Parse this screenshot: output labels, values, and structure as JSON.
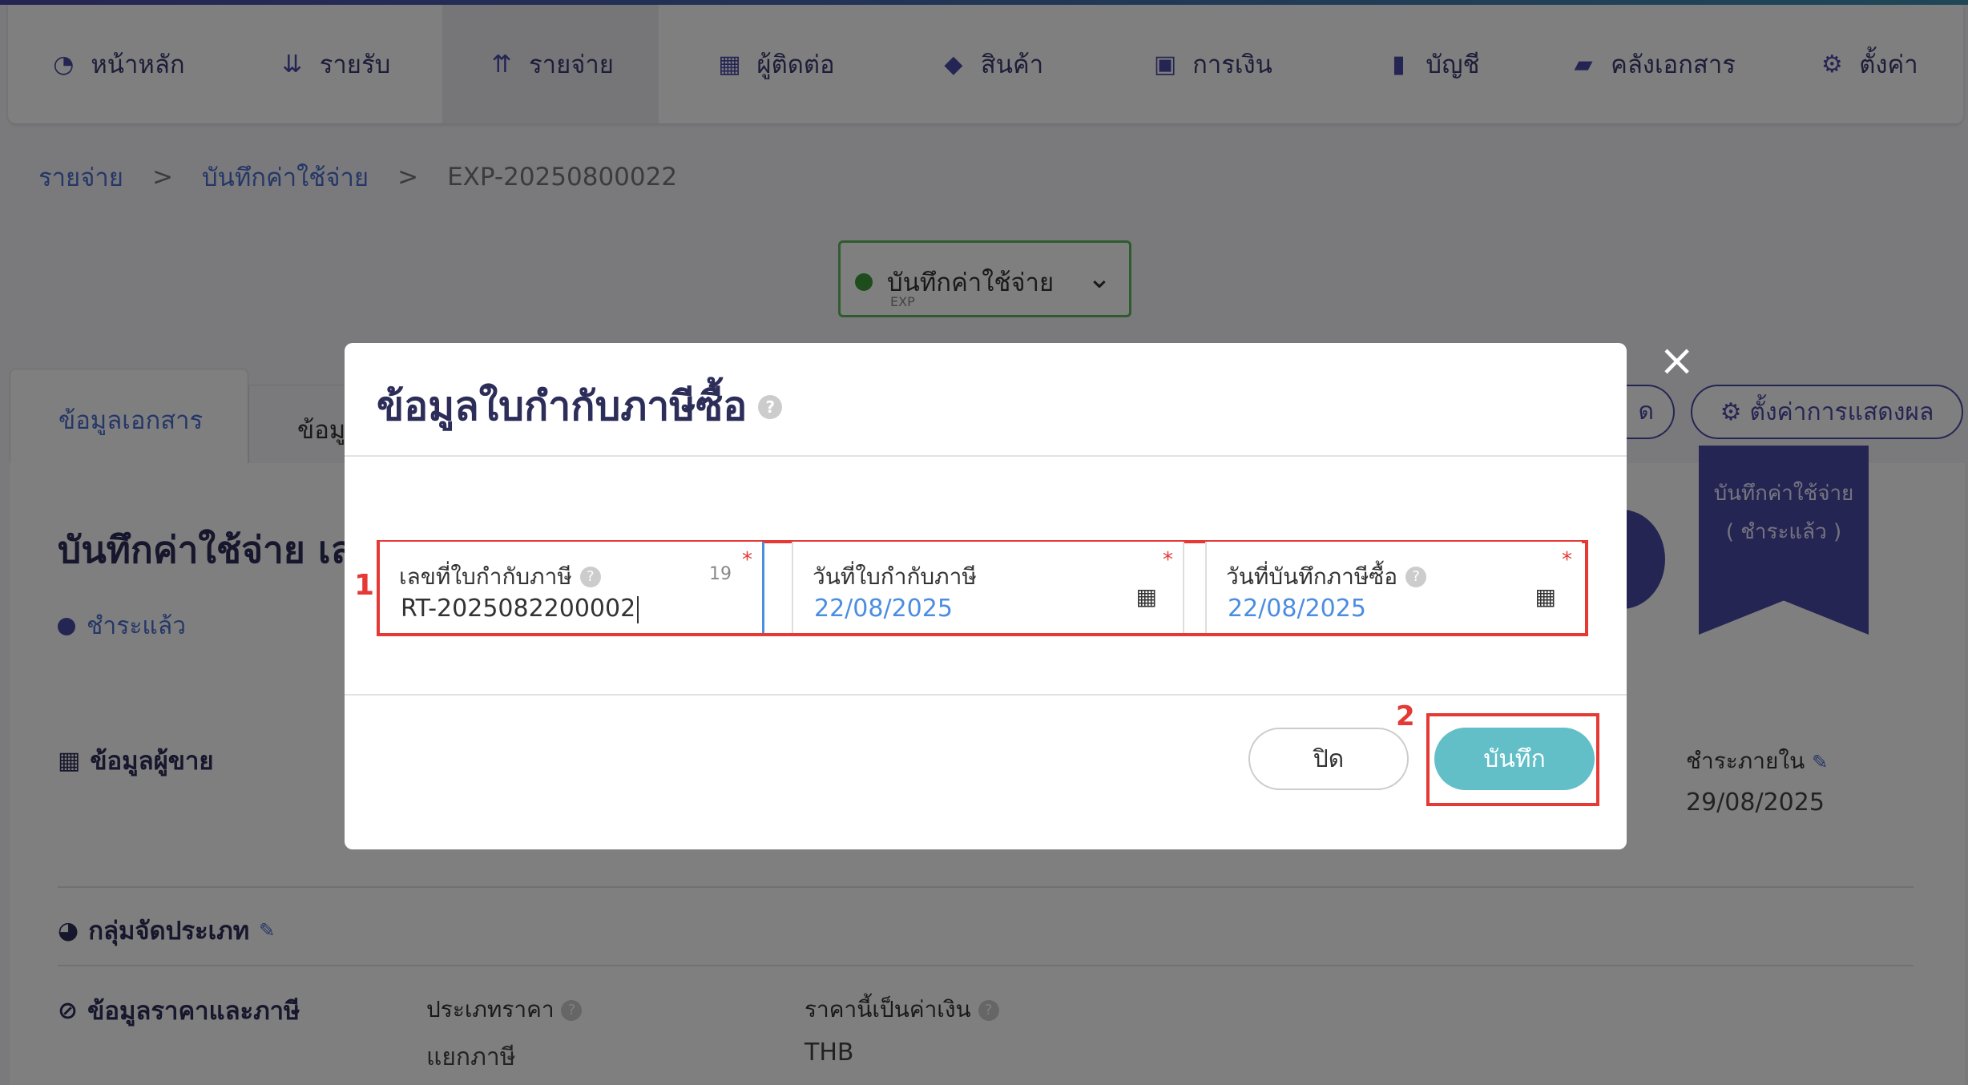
{
  "nav": {
    "items": [
      {
        "label": "หน้าหลัก",
        "icon": "dashboard-icon",
        "glyph": "◔"
      },
      {
        "label": "รายรับ",
        "icon": "income-icon",
        "glyph": "⇊"
      },
      {
        "label": "รายจ่าย",
        "icon": "expense-icon",
        "glyph": "⇈"
      },
      {
        "label": "ผู้ติดต่อ",
        "icon": "contacts-icon",
        "glyph": "▦"
      },
      {
        "label": "สินค้า",
        "icon": "box-icon",
        "glyph": "◆"
      },
      {
        "label": "การเงิน",
        "icon": "money-icon",
        "glyph": "▣"
      },
      {
        "label": "บัญชี",
        "icon": "ledger-icon",
        "glyph": "▮"
      },
      {
        "label": "คลังเอกสาร",
        "icon": "folder-icon",
        "glyph": "▰"
      },
      {
        "label": "ตั้งค่า",
        "icon": "gear-icon",
        "glyph": "⚙"
      }
    ]
  },
  "breadcrumb": {
    "items": [
      "รายจ่าย",
      "บันทึกค่าใช้จ่าย",
      "EXP-20250800022"
    ],
    "sep": ">"
  },
  "status_dropdown": {
    "label": "บันทึกค่าใช้จ่าย",
    "sub": "EXP"
  },
  "tabs": {
    "active": "ข้อมูลเอกสาร",
    "second": "ข้อมู"
  },
  "doc": {
    "title": "บันทึกค่าใช้จ่าย เล",
    "status": "ชำระแล้ว"
  },
  "toolbar": {
    "settings": "ตั้งค่าการแสดงผล",
    "partial": "ด"
  },
  "ribbon": {
    "line1": "บันทึกค่าใช้จ่าย",
    "line2": "( ชำระแล้ว )"
  },
  "sections": {
    "vendor": "ข้อมูลผู้ขาย",
    "group": "กลุ่มจัดประเภท",
    "price": "ข้อมูลราคาและภาษี"
  },
  "fields": {
    "price_type_label": "ประเภทราคา",
    "price_type_value": "แยกภาษี",
    "currency_label": "ราคานี้เป็นค่าเงิน",
    "currency_value": "THB",
    "due_label": "ชำระภายใน",
    "due_value": "29/08/2025"
  },
  "modal": {
    "title": "ข้อมูลใบกำกับภาษีซื้อ",
    "field1": {
      "label": "เลขที่ใบกำกับภาษี",
      "value": "RT-2025082200002",
      "count": "19"
    },
    "field2": {
      "label": "วันที่ใบกำกับภาษี",
      "value": "22/08/2025"
    },
    "field3": {
      "label": "วันที่บันทึกภาษีซื้อ",
      "value": "22/08/2025"
    },
    "required_mark": "*",
    "close_btn": "ปิด",
    "save_btn": "บันทึก",
    "marker1": "1",
    "marker2": "2"
  },
  "colors": {
    "brand": "#4b4aa8",
    "save": "#62bfc8",
    "highlight": "#e53935"
  }
}
